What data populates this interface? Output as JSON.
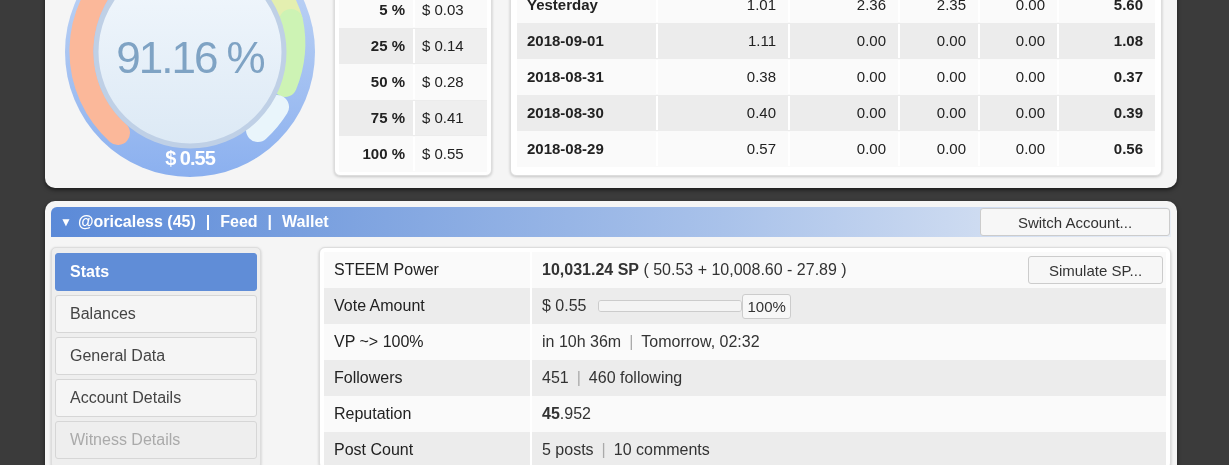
{
  "gauge": {
    "percent": "91.16 %",
    "value": "$ 0.55"
  },
  "vote_table": {
    "rows": [
      {
        "weight": "5 %",
        "value": "$ 0.03"
      },
      {
        "weight": "25 %",
        "value": "$ 0.14"
      },
      {
        "weight": "50 %",
        "value": "$ 0.28"
      },
      {
        "weight": "75 %",
        "value": "$ 0.41"
      },
      {
        "weight": "100 %",
        "value": "$ 0.55"
      }
    ]
  },
  "rewards_table": {
    "rows": [
      {
        "date": "Yesterday",
        "cells": [
          "1.01",
          "2.36",
          "2.35",
          "0.00"
        ],
        "total": "5.60"
      },
      {
        "date": "2018-09-01",
        "cells": [
          "1.11",
          "0.00",
          "0.00",
          "0.00"
        ],
        "total": "1.08"
      },
      {
        "date": "2018-08-31",
        "cells": [
          "0.38",
          "0.00",
          "0.00",
          "0.00"
        ],
        "total": "0.37"
      },
      {
        "date": "2018-08-30",
        "cells": [
          "0.40",
          "0.00",
          "0.00",
          "0.00"
        ],
        "total": "0.39"
      },
      {
        "date": "2018-08-29",
        "cells": [
          "0.57",
          "0.00",
          "0.00",
          "0.00"
        ],
        "total": "0.56"
      }
    ]
  },
  "account_bar": {
    "caret": "▼",
    "links": [
      "@oricaless (45)",
      "Feed",
      "Wallet"
    ],
    "separator": "|",
    "button": "Switch Account..."
  },
  "sidebar": {
    "items": [
      {
        "label": "Stats",
        "selected": true,
        "disabled": false
      },
      {
        "label": "Balances",
        "selected": false,
        "disabled": false
      },
      {
        "label": "General Data",
        "selected": false,
        "disabled": false
      },
      {
        "label": "Account Details",
        "selected": false,
        "disabled": false
      },
      {
        "label": "Witness Details",
        "selected": false,
        "disabled": true
      }
    ]
  },
  "stats": {
    "rows": [
      {
        "kind": "text",
        "label": "STEEM Power",
        "parts": [
          "**10,031.24 SP** ( 50.53 + 10,008.60 - 27.89 )"
        ],
        "button": "Simulate SP..."
      },
      {
        "kind": "slider",
        "label": "Vote Amount",
        "parts": [
          "$ 0.55"
        ],
        "level": 1.0,
        "reading": "100%"
      },
      {
        "kind": "text",
        "label": "VP ~> 100%",
        "parts": [
          "in 10h 36m",
          "Tomorrow, 02:32"
        ]
      },
      {
        "kind": "text",
        "label": "Followers",
        "parts": [
          "451",
          "460 following"
        ]
      },
      {
        "kind": "text",
        "label": "Reputation",
        "parts": [
          "**45**.952"
        ]
      },
      {
        "kind": "text",
        "label": "Post Count",
        "parts": [
          "5 posts",
          "10 comments"
        ]
      }
    ],
    "separator": "|"
  }
}
